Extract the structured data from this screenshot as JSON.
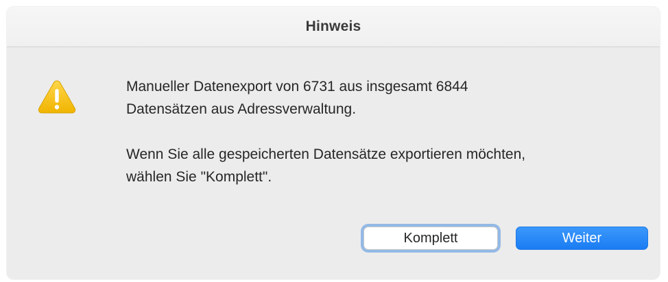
{
  "dialog": {
    "title": "Hinweis",
    "icon": "warning-icon",
    "message_line1": "Manueller Datenexport von 6731 aus insgesamt 6844\nDatensätzen aus Adressverwaltung.",
    "message_line2": "Wenn Sie alle gespeicherten Datensätze exportieren möchten,\nwählen Sie \"Komplett\".",
    "buttons": {
      "secondary_label": "Komplett",
      "primary_label": "Weiter"
    }
  },
  "colors": {
    "accent": "#1a7cf3",
    "warning": "#f5c518",
    "background": "#ececec"
  }
}
